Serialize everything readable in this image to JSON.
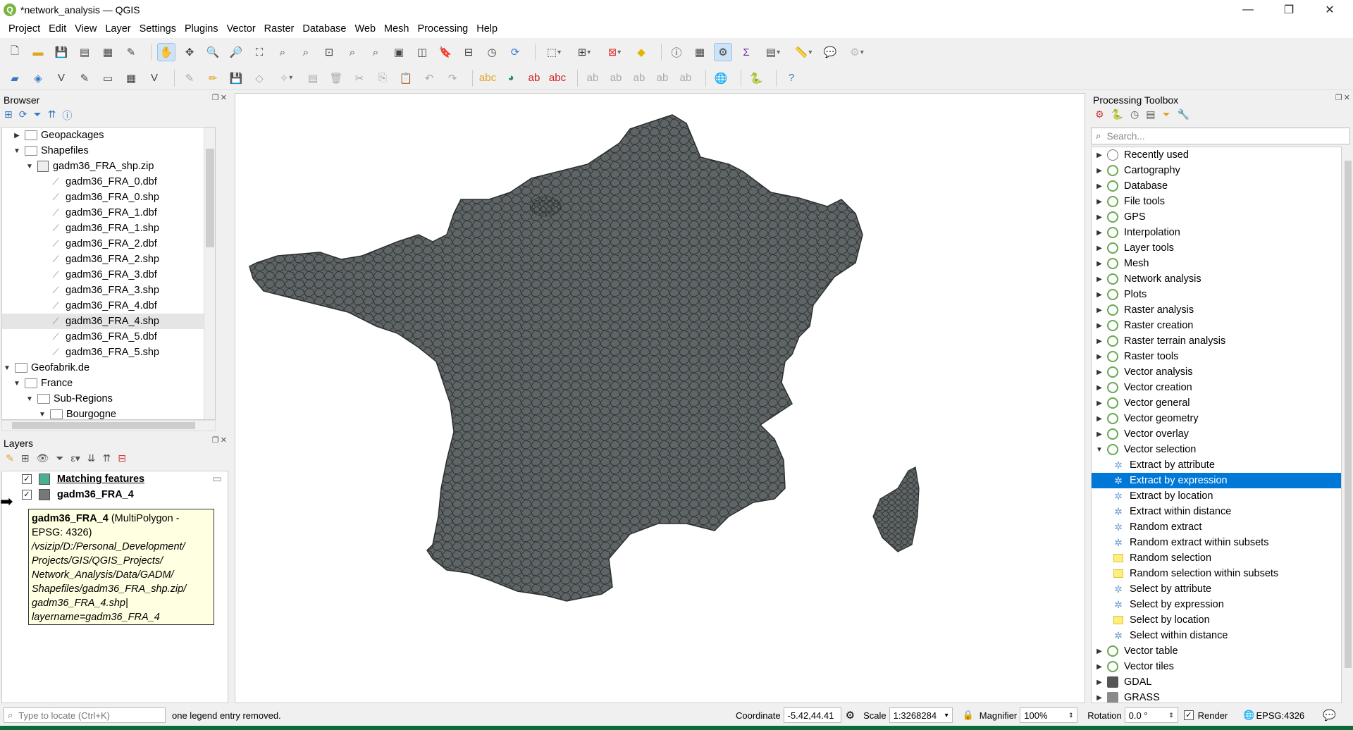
{
  "window": {
    "title": "*network_analysis — QGIS",
    "logo": "Q"
  },
  "menu": [
    "Project",
    "Edit",
    "View",
    "Layer",
    "Settings",
    "Plugins",
    "Vector",
    "Raster",
    "Database",
    "Web",
    "Mesh",
    "Processing",
    "Help"
  ],
  "browser": {
    "title": "Browser",
    "items": [
      {
        "label": "Geopackages",
        "indent": 0,
        "arrow": "▶",
        "icon": "folder"
      },
      {
        "label": "Shapefiles",
        "indent": 0,
        "arrow": "▼",
        "icon": "folder"
      },
      {
        "label": "gadm36_FRA_shp.zip",
        "indent": 1,
        "arrow": "▼",
        "icon": "zip"
      },
      {
        "label": "gadm36_FRA_0.dbf",
        "indent": 2,
        "arrow": "",
        "icon": "vector"
      },
      {
        "label": "gadm36_FRA_0.shp",
        "indent": 2,
        "arrow": "",
        "icon": "vector"
      },
      {
        "label": "gadm36_FRA_1.dbf",
        "indent": 2,
        "arrow": "",
        "icon": "vector"
      },
      {
        "label": "gadm36_FRA_1.shp",
        "indent": 2,
        "arrow": "",
        "icon": "vector"
      },
      {
        "label": "gadm36_FRA_2.dbf",
        "indent": 2,
        "arrow": "",
        "icon": "vector"
      },
      {
        "label": "gadm36_FRA_2.shp",
        "indent": 2,
        "arrow": "",
        "icon": "vector"
      },
      {
        "label": "gadm36_FRA_3.dbf",
        "indent": 2,
        "arrow": "",
        "icon": "vector"
      },
      {
        "label": "gadm36_FRA_3.shp",
        "indent": 2,
        "arrow": "",
        "icon": "vector"
      },
      {
        "label": "gadm36_FRA_4.dbf",
        "indent": 2,
        "arrow": "",
        "icon": "vector"
      },
      {
        "label": "gadm36_FRA_4.shp",
        "indent": 2,
        "arrow": "",
        "icon": "vector",
        "selected": true
      },
      {
        "label": "gadm36_FRA_5.dbf",
        "indent": 2,
        "arrow": "",
        "icon": "vector"
      },
      {
        "label": "gadm36_FRA_5.shp",
        "indent": 2,
        "arrow": "",
        "icon": "vector"
      },
      {
        "label": "Geofabrik.de",
        "indent": -1,
        "arrow": "▼",
        "icon": "folder"
      },
      {
        "label": "France",
        "indent": 0,
        "arrow": "▼",
        "icon": "folder"
      },
      {
        "label": "Sub-Regions",
        "indent": 1,
        "arrow": "▼",
        "icon": "folder"
      },
      {
        "label": "Bourgogne",
        "indent": 2,
        "arrow": "▼",
        "icon": "folder"
      }
    ]
  },
  "layers": {
    "title": "Layers",
    "items": [
      {
        "label": "Matching features",
        "checked": true,
        "color": "#4caf93",
        "underline": true
      },
      {
        "label": "gadm36_FRA_4",
        "checked": true,
        "color": "#777777",
        "underline": false
      }
    ],
    "tooltip": {
      "name": "gadm36_FRA_4",
      "geom": " (MultiPolygon - EPSG: 4326)",
      "lines": [
        "/vsizip/D:/Personal_Development/",
        "Projects/GIS/QGIS_Projects/",
        "Network_Analysis/Data/GADM/",
        "Shapefiles/gadm36_FRA_shp.zip/",
        "gadm36_FRA_4.shp|",
        "layername=gadm36_FRA_4"
      ]
    }
  },
  "processing": {
    "title": "Processing Toolbox",
    "search_placeholder": "Search...",
    "items": [
      {
        "label": "Recently used",
        "type": "clock",
        "arrow": "▶"
      },
      {
        "label": "Cartography",
        "type": "group",
        "arrow": "▶"
      },
      {
        "label": "Database",
        "type": "group",
        "arrow": "▶"
      },
      {
        "label": "File tools",
        "type": "group",
        "arrow": "▶"
      },
      {
        "label": "GPS",
        "type": "group",
        "arrow": "▶"
      },
      {
        "label": "Interpolation",
        "type": "group",
        "arrow": "▶"
      },
      {
        "label": "Layer tools",
        "type": "group",
        "arrow": "▶"
      },
      {
        "label": "Mesh",
        "type": "group",
        "arrow": "▶"
      },
      {
        "label": "Network analysis",
        "type": "group",
        "arrow": "▶"
      },
      {
        "label": "Plots",
        "type": "group",
        "arrow": "▶"
      },
      {
        "label": "Raster analysis",
        "type": "group",
        "arrow": "▶"
      },
      {
        "label": "Raster creation",
        "type": "group",
        "arrow": "▶"
      },
      {
        "label": "Raster terrain analysis",
        "type": "group",
        "arrow": "▶"
      },
      {
        "label": "Raster tools",
        "type": "group",
        "arrow": "▶"
      },
      {
        "label": "Vector analysis",
        "type": "group",
        "arrow": "▶"
      },
      {
        "label": "Vector creation",
        "type": "group",
        "arrow": "▶"
      },
      {
        "label": "Vector general",
        "type": "group",
        "arrow": "▶"
      },
      {
        "label": "Vector geometry",
        "type": "group",
        "arrow": "▶"
      },
      {
        "label": "Vector overlay",
        "type": "group",
        "arrow": "▶"
      },
      {
        "label": "Vector selection",
        "type": "group",
        "arrow": "▼"
      },
      {
        "label": "Extract by attribute",
        "type": "algo"
      },
      {
        "label": "Extract by expression",
        "type": "algo",
        "selected": true
      },
      {
        "label": "Extract by location",
        "type": "algo"
      },
      {
        "label": "Extract within distance",
        "type": "algo"
      },
      {
        "label": "Random extract",
        "type": "algo"
      },
      {
        "label": "Random extract within subsets",
        "type": "algo"
      },
      {
        "label": "Random selection",
        "type": "select"
      },
      {
        "label": "Random selection within subsets",
        "type": "select"
      },
      {
        "label": "Select by attribute",
        "type": "algo"
      },
      {
        "label": "Select by expression",
        "type": "algo"
      },
      {
        "label": "Select by location",
        "type": "select"
      },
      {
        "label": "Select within distance",
        "type": "algo"
      },
      {
        "label": "Vector table",
        "type": "group",
        "arrow": "▶"
      },
      {
        "label": "Vector tiles",
        "type": "group",
        "arrow": "▶"
      },
      {
        "label": "GDAL",
        "type": "gdal",
        "arrow": "▶"
      },
      {
        "label": "GRASS",
        "type": "grass",
        "arrow": "▶"
      }
    ]
  },
  "status": {
    "locate_placeholder": "Type to locate (Ctrl+K)",
    "message": "one legend entry removed.",
    "coordinate_label": "Coordinate",
    "coordinate": "-5.42,44.41",
    "scale_label": "Scale",
    "scale": "1:3268284",
    "magnifier_label": "Magnifier",
    "magnifier": "100%",
    "rotation_label": "Rotation",
    "rotation": "0.0 °",
    "render_label": "Render",
    "crs": "EPSG:4326"
  },
  "colors": {
    "map_fill": "#5f6566",
    "selection": "#0078d7",
    "qgis_green": "#6aa84f"
  }
}
